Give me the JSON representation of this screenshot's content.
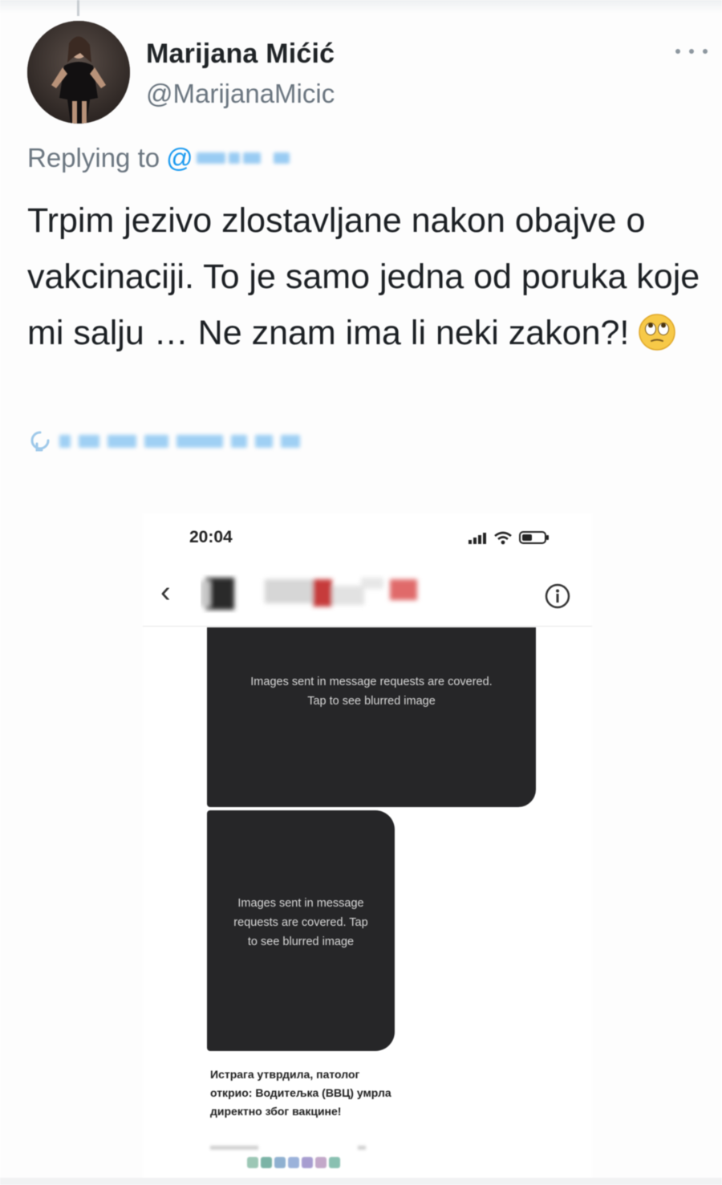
{
  "tweet": {
    "author_name": "Marijana Mićić",
    "author_handle": "@MarijanaMicic",
    "replying_to_prefix": "Replying to",
    "replying_to_at": "@",
    "text": "Trpim jezivo zlostavljane nakon obajve o vakcinaciji. To je samo jedna od poruka koje mi salju  … Ne znam ima li neki zakon?!",
    "emoji": "face-with-rolling-eyes"
  },
  "embedded_screenshot": {
    "status_time": "20:04",
    "bubble_1_text": "Images sent in message requests are covered. Tap to see blurred image",
    "bubble_2_text": "Images sent in message requests are covered. Tap to see blurred image",
    "caption": "Истрага утврдила, патолог открио: Водитељка (ВВЦ) умрла директно због вакцине!"
  },
  "colors": {
    "text_primary": "#1b1f23",
    "text_secondary": "#6b7680",
    "link": "#1d9bf0",
    "bubble": "#262628",
    "bubble_text": "#d9d9d9"
  },
  "icons": {
    "more": "more-horizontal-icon",
    "back": "chevron-left-icon",
    "info": "info-icon",
    "link": "link-icon",
    "signal": "cell-signal-icon",
    "wifi": "wifi-icon",
    "battery": "battery-icon"
  }
}
